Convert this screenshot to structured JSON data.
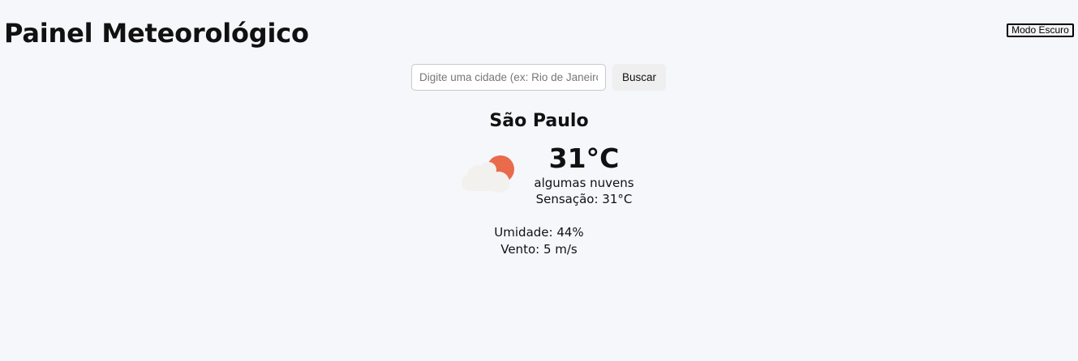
{
  "header": {
    "title": "Painel Meteorológico",
    "mode_toggle_label": "Modo Escuro"
  },
  "search": {
    "placeholder": "Digite uma cidade (ex: Rio de Janeiro)",
    "value": "",
    "button_label": "Buscar"
  },
  "weather": {
    "city": "São Paulo",
    "temperature": "31°C",
    "description": "algumas nuvens",
    "feels_like": "Sensação: 31°C",
    "humidity": "Umidade: 44%",
    "wind": "Vento: 5 m/s",
    "icon": "partly-cloudy-icon"
  },
  "colors": {
    "background": "#f6f7fb",
    "sun": "#ea6a4c",
    "cloud": "#f2f1ee"
  }
}
